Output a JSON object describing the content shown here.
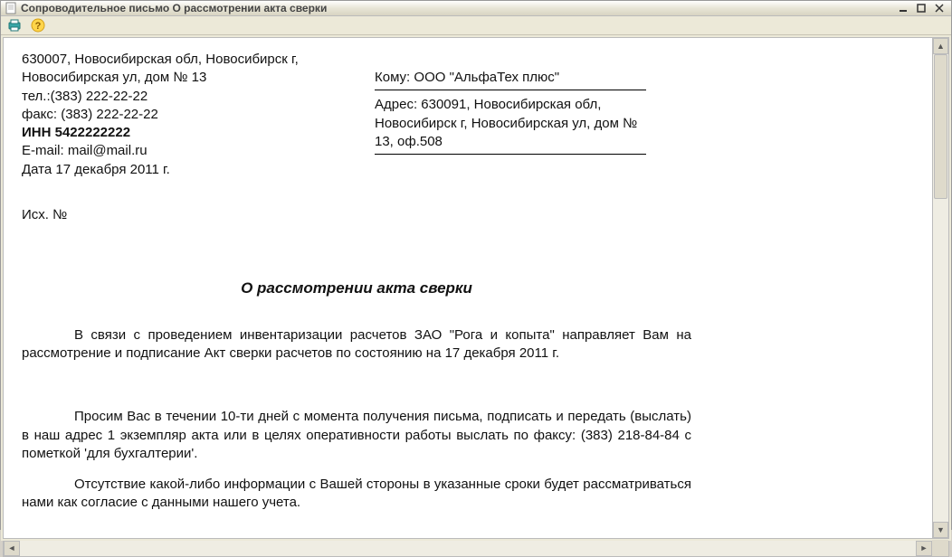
{
  "window": {
    "title": "Сопроводительное письмо О рассмотрении акта сверки"
  },
  "sender": {
    "address": "630007, Новосибирская обл, Новосибирск г, Новосибирская ул, дом № 13",
    "phone": "тел.:(383) 222-22-22",
    "fax": "факс: (383) 222-22-22",
    "inn": "ИНН 5422222222",
    "email": "E-mail: mail@mail.ru",
    "date": "Дата  17 декабря 2011 г.",
    "outgoing": "Исх. №"
  },
  "recipient": {
    "to": "Кому: ООО \"АльфаТех плюс\"",
    "address": "Адрес: 630091, Новосибирская обл, Новосибирск г, Новосибирская ул, дом № 13, оф.508"
  },
  "document": {
    "title": "О рассмотрении акта сверки",
    "para1": "В связи с проведением инвентаризации расчетов ЗАО \"Рога и копыта\" направляет Вам на рассмотрение и подписание Акт сверки расчетов  по состоянию на 17 декабря 2011 г.",
    "para2": "Просим Вас в течении 10-ти дней с момента получения письма, подписать и передать (выслать) в наш адрес 1 экземпляр акта или в целях оперативности работы выслать по факсу: (383) 218-84-84 с пометкой 'для бухгалтерии'.",
    "para3": "Отсутствие какой-либо информации с Вашей стороны в указанные сроки будет рассматриваться нами как согласие с данными нашего учета."
  }
}
